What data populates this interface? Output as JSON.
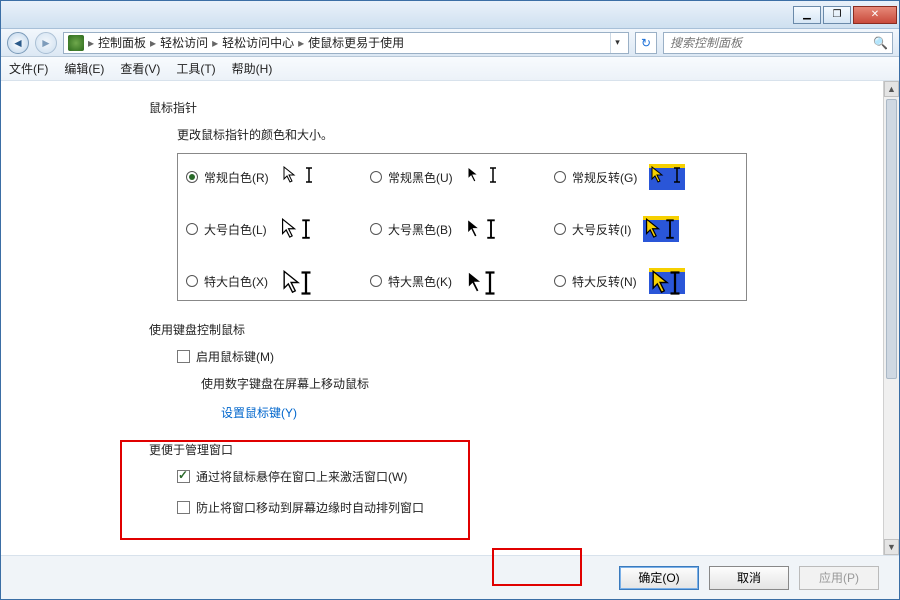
{
  "breadcrumb": {
    "items": [
      "控制面板",
      "轻松访问",
      "轻松访问中心",
      "使鼠标更易于使用"
    ]
  },
  "search": {
    "placeholder": "搜索控制面板"
  },
  "menu": {
    "file": "文件(F)",
    "edit": "编辑(E)",
    "view": "查看(V)",
    "tools": "工具(T)",
    "help": "帮助(H)"
  },
  "pointers": {
    "section_title": "鼠标指针",
    "section_sub": "更改鼠标指针的颜色和大小。",
    "opts": [
      {
        "label": "常规白色(R)",
        "checked": true
      },
      {
        "label": "常规黑色(U)",
        "checked": false
      },
      {
        "label": "常规反转(G)",
        "checked": false
      },
      {
        "label": "大号白色(L)",
        "checked": false
      },
      {
        "label": "大号黑色(B)",
        "checked": false
      },
      {
        "label": "大号反转(I)",
        "checked": false
      },
      {
        "label": "特大白色(X)",
        "checked": false
      },
      {
        "label": "特大黑色(K)",
        "checked": false
      },
      {
        "label": "特大反转(N)",
        "checked": false
      }
    ]
  },
  "keyboard": {
    "title": "使用键盘控制鼠标",
    "enable": {
      "label": "启用鼠标键(M)",
      "checked": false
    },
    "desc": "使用数字键盘在屏幕上移动鼠标",
    "link": "设置鼠标键(Y)"
  },
  "windows": {
    "title": "更便于管理窗口",
    "hover": {
      "label": "通过将鼠标悬停在窗口上来激活窗口(W)",
      "checked": true
    },
    "snap": {
      "label": "防止将窗口移动到屏幕边缘时自动排列窗口",
      "checked": false
    }
  },
  "buttons": {
    "ok": "确定(O)",
    "cancel": "取消",
    "apply": "应用(P)"
  }
}
